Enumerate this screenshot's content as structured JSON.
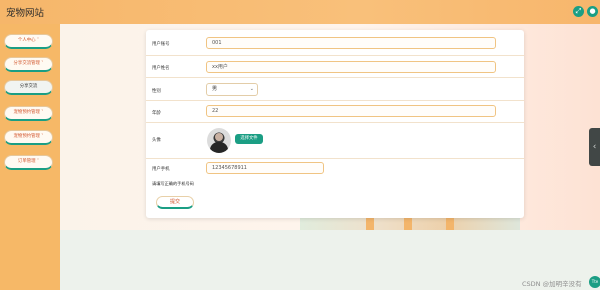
{
  "header": {
    "title": "宠物网站",
    "icons": [
      "fullscreen-icon",
      "user-icon"
    ]
  },
  "sidebar": {
    "items": [
      {
        "label": "个人中心 ˅"
      },
      {
        "label": "分享交流管理 ˅"
      },
      {
        "label": "分享交流"
      },
      {
        "label": "宠物预约管理 ˅"
      },
      {
        "label": "宠物预约管理 ˅"
      },
      {
        "label": "订单管理 ˅"
      }
    ]
  },
  "form": {
    "account_label": "用户账号",
    "account_value": "001",
    "name_label": "用户姓名",
    "name_value": "xx用户",
    "gender_label": "性别",
    "gender_value": "男",
    "age_label": "年龄",
    "age_value": "22",
    "avatar_label": "头像",
    "choose_file": "选择文件",
    "phone_label": "用户手机",
    "phone_value": "12345678911",
    "phone_hint": "请填写正确的手机号码",
    "submit": "提交"
  },
  "watermark": {
    "text": "CSDN @加明辛没有",
    "badge": "Tte"
  },
  "colors": {
    "accent": "#1b9e84",
    "sidebar": "#f6b867",
    "input_border": "#f0c483"
  }
}
